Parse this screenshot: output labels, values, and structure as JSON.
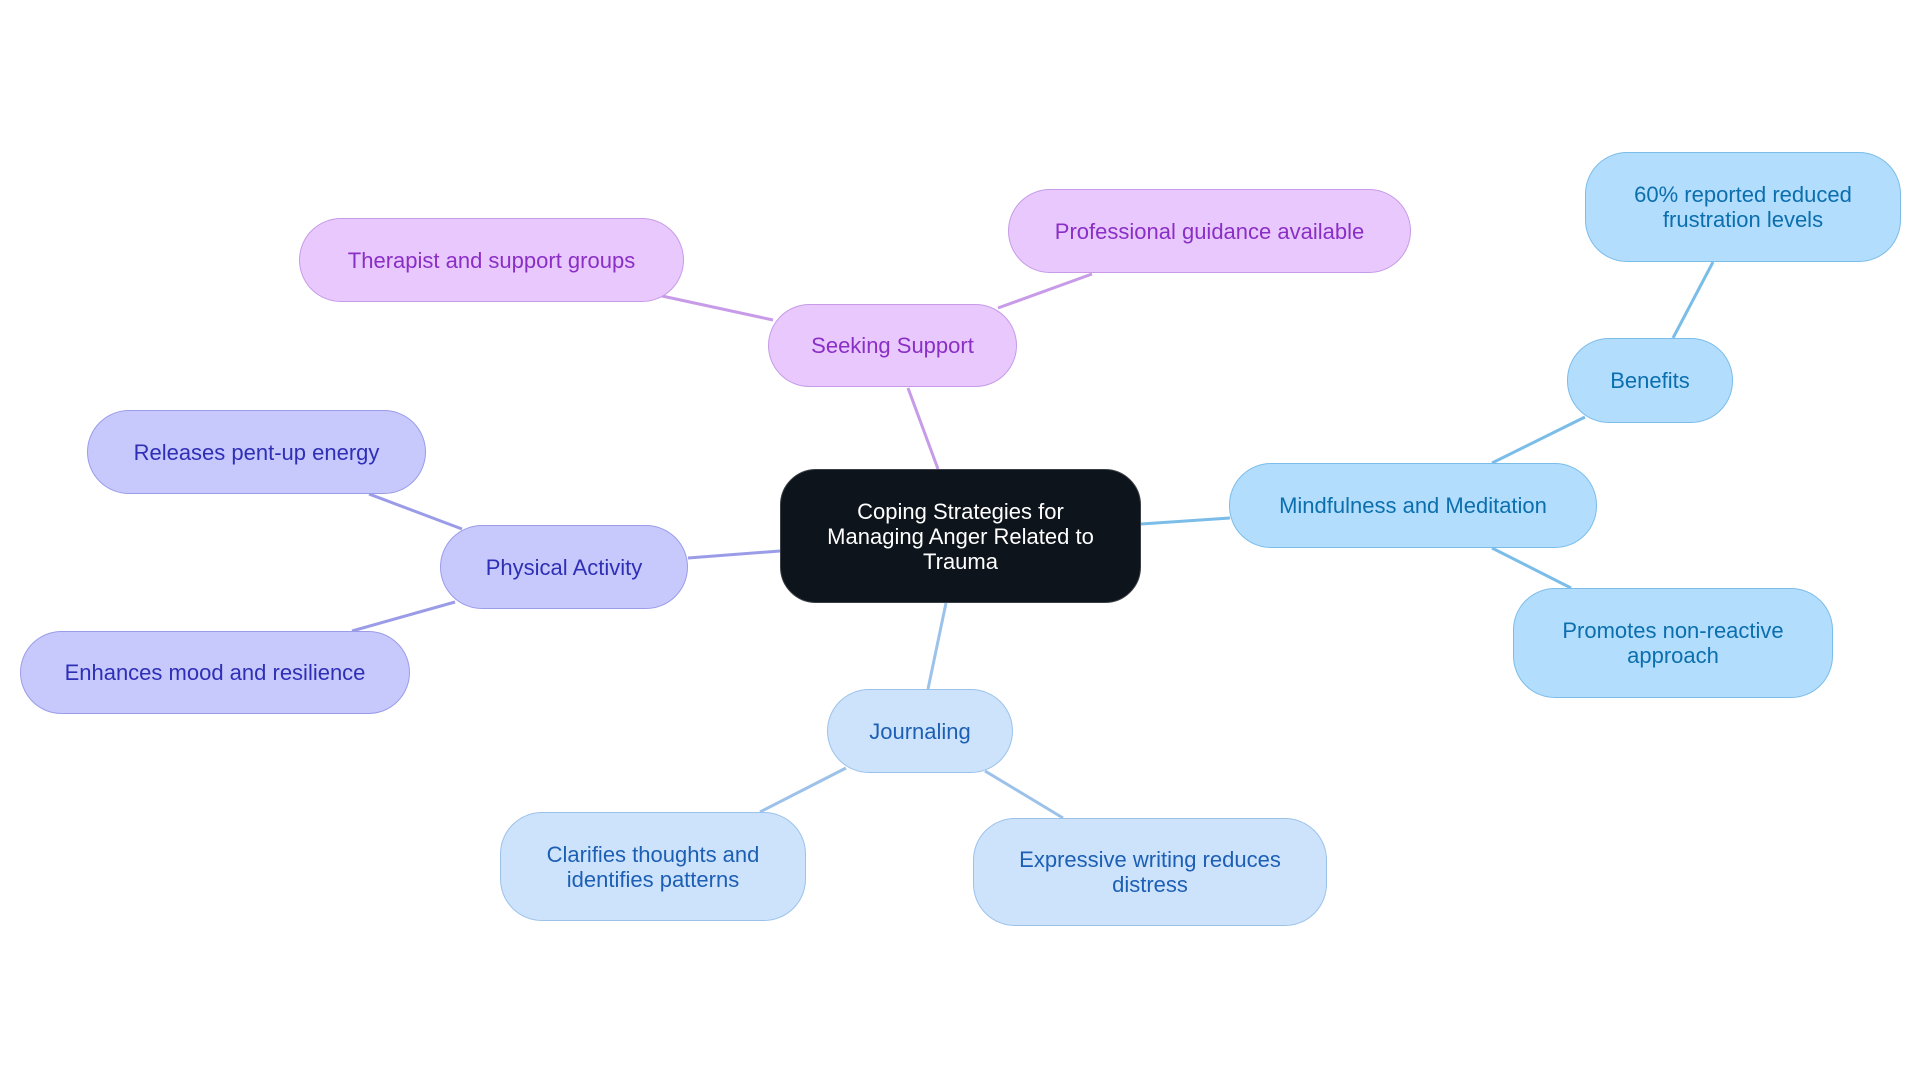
{
  "title": "Coping Strategies for Managing Anger Related to Trauma",
  "colors": {
    "root_fill": "#0d141b",
    "purple_line": "#c79be8",
    "indigo_line": "#9b9ce8",
    "sky_line": "#7bbde9",
    "pale_line": "#9cc2ea"
  },
  "nodes": {
    "root": "Coping Strategies for\nManaging Anger Related to\nTrauma",
    "seeking_support": "Seeking Support",
    "therapist": "Therapist and support groups",
    "professional": "Professional guidance available",
    "physical_activity": "Physical Activity",
    "releases": "Releases pent-up energy",
    "enhances": "Enhances mood and resilience",
    "journaling": "Journaling",
    "clarifies": "Clarifies thoughts and\nidentifies patterns",
    "expressive": "Expressive writing reduces\ndistress",
    "mindfulness": "Mindfulness and Meditation",
    "benefits": "Benefits",
    "sixty_percent": "60% reported reduced\nfrustration levels",
    "promotes": "Promotes non-reactive\napproach"
  },
  "edges": [
    {
      "from": "root",
      "to": "seeking_support",
      "color": "purple_line"
    },
    {
      "from": "seeking_support",
      "to": "therapist",
      "color": "purple_line"
    },
    {
      "from": "seeking_support",
      "to": "professional",
      "color": "purple_line"
    },
    {
      "from": "root",
      "to": "physical_activity",
      "color": "indigo_line"
    },
    {
      "from": "physical_activity",
      "to": "releases",
      "color": "indigo_line"
    },
    {
      "from": "physical_activity",
      "to": "enhances",
      "color": "indigo_line"
    },
    {
      "from": "root",
      "to": "journaling",
      "color": "pale_line"
    },
    {
      "from": "journaling",
      "to": "clarifies",
      "color": "pale_line"
    },
    {
      "from": "journaling",
      "to": "expressive",
      "color": "pale_line"
    },
    {
      "from": "root",
      "to": "mindfulness",
      "color": "sky_line"
    },
    {
      "from": "mindfulness",
      "to": "benefits",
      "color": "sky_line"
    },
    {
      "from": "benefits",
      "to": "sixty_percent",
      "color": "sky_line"
    },
    {
      "from": "mindfulness",
      "to": "promotes",
      "color": "sky_line"
    }
  ]
}
